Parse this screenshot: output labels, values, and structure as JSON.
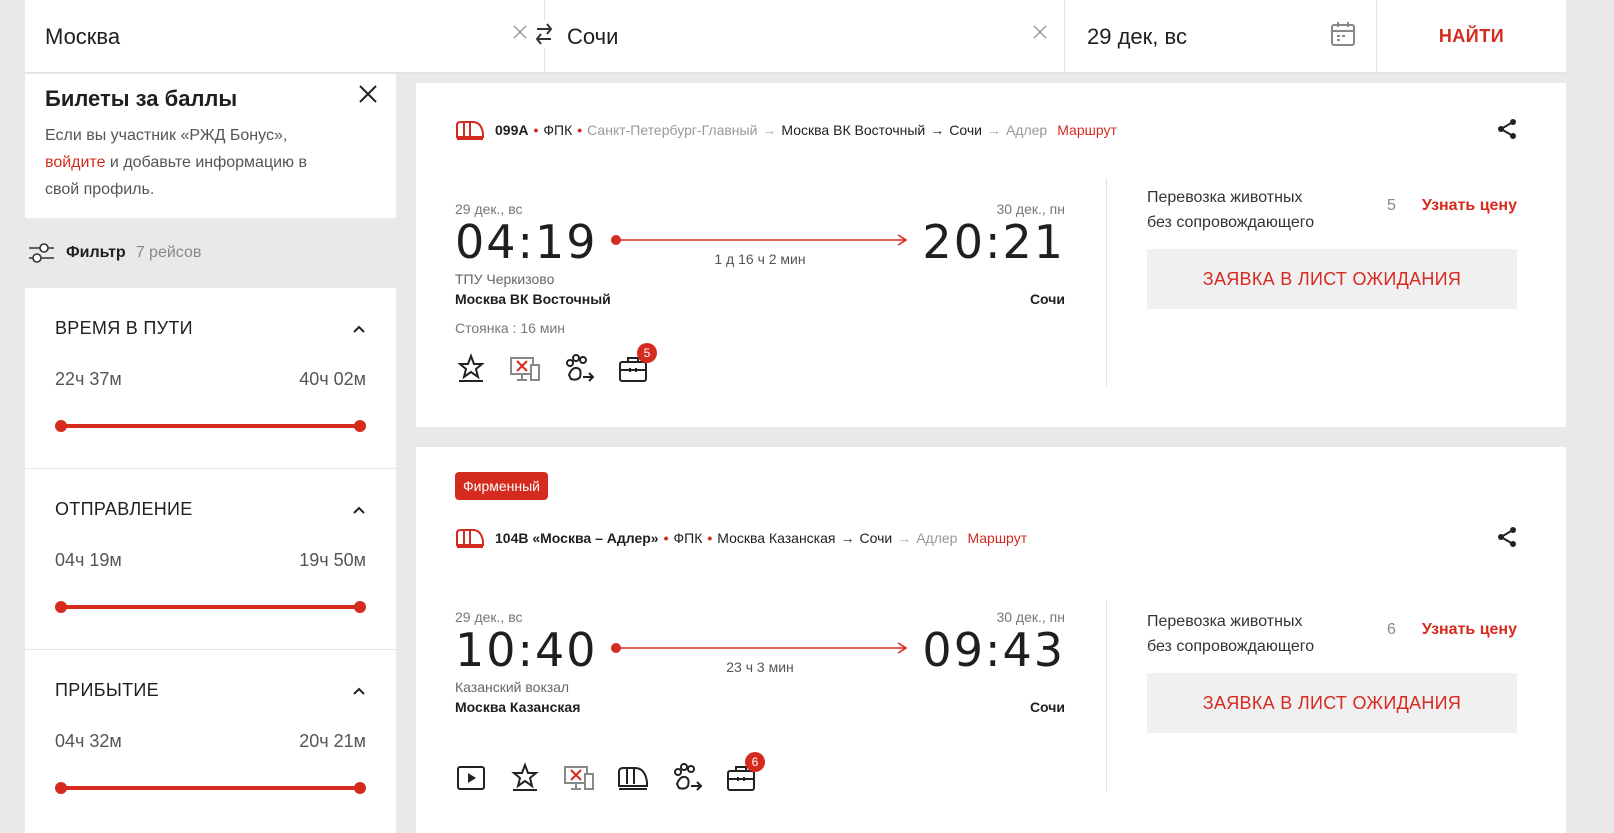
{
  "search": {
    "from": "Москва",
    "to": "Сочи",
    "date": "29 дек, вс",
    "find_label": "НАЙТИ"
  },
  "bonus": {
    "title": "Билеты за баллы",
    "text_before": "Если вы участник «РЖД Бонус», ",
    "link": "войдите",
    "text_after": " и добавьте информацию в свой профиль."
  },
  "filter": {
    "label": "Фильтр",
    "count": "7 рейсов",
    "panels": [
      {
        "title": "ВРЕМЯ В ПУТИ",
        "min": "22ч 37м",
        "max": "40ч 02м"
      },
      {
        "title": "ОТПРАВЛЕНИЕ",
        "min": "04ч 19м",
        "max": "19ч 50м"
      },
      {
        "title": "ПРИБЫТИЕ",
        "min": "04ч 32м",
        "max": "20ч 21м"
      }
    ]
  },
  "trains": [
    {
      "number": "099А",
      "carrier": "ФПК",
      "origin": "Санкт-Петербург-Главный",
      "from_station": "Москва ВК Восточный",
      "to_station": "Сочи",
      "terminus": "Адлер",
      "route_link": "Маршрут",
      "dep_date": "29 дек., вс",
      "dep_time": "04:19",
      "arr_date": "30 дек., пн",
      "arr_time": "20:21",
      "duration": "1 д 16 ч 2 мин",
      "dep_sub": "ТПУ Черкизово",
      "dep_station": "Москва ВК Восточный",
      "arr_station": "Сочи",
      "stop": "Стоянка : 16 мин",
      "amenities": [
        "star-service-icon",
        "no-electronic-registration-icon",
        "pets-transport-icon",
        "luggage-icon"
      ],
      "luggage_count": "5",
      "offer_label_1": "Перевозка животных",
      "offer_label_2": "без сопровождающего",
      "offer_count": "5",
      "offer_price": "Узнать цену",
      "wait_button": "ЗАЯВКА В ЛИСТ ОЖИДАНИЯ"
    },
    {
      "badge": "Фирменный",
      "number": "104В «Москва – Адлер»",
      "carrier": "ФПК",
      "from_station": "Москва Казанская",
      "to_station": "Сочи",
      "terminus": "Адлер",
      "route_link": "Маршрут",
      "dep_date": "29 дек., вс",
      "dep_time": "10:40",
      "arr_date": "30 дек., пн",
      "arr_time": "09:43",
      "duration": "23 ч 3 мин",
      "dep_sub": "Казанский вокзал",
      "dep_station": "Москва Казанская",
      "arr_station": "Сочи",
      "amenities": [
        "video-icon",
        "star-service-icon",
        "no-electronic-registration-icon",
        "train-icon",
        "pets-transport-icon",
        "luggage-icon"
      ],
      "luggage_count": "6",
      "offer_label_1": "Перевозка животных",
      "offer_label_2": "без сопровождающего",
      "offer_count": "6",
      "offer_price": "Узнать цену",
      "wait_button": "ЗАЯВКА В ЛИСТ ОЖИДАНИЯ"
    }
  ],
  "colors": {
    "accent": "#d52b1e",
    "background": "#e9e9ec"
  }
}
